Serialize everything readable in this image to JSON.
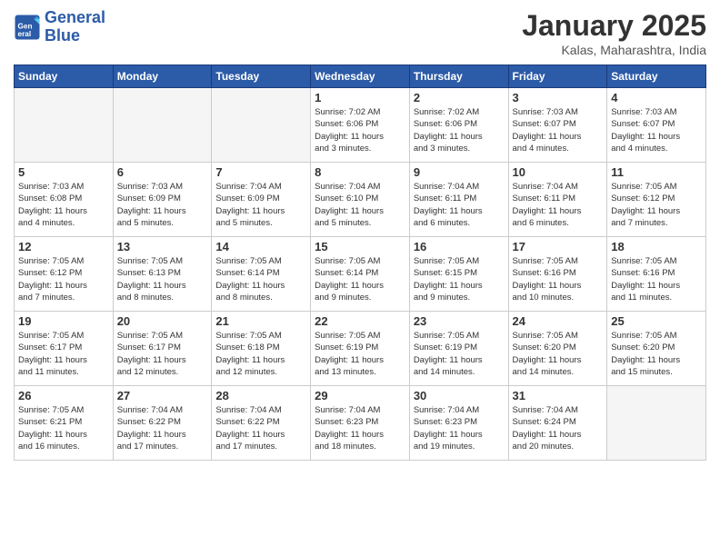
{
  "header": {
    "logo_line1": "General",
    "logo_line2": "Blue",
    "month": "January 2025",
    "location": "Kalas, Maharashtra, India"
  },
  "weekdays": [
    "Sunday",
    "Monday",
    "Tuesday",
    "Wednesday",
    "Thursday",
    "Friday",
    "Saturday"
  ],
  "weeks": [
    [
      {
        "day": "",
        "info": ""
      },
      {
        "day": "",
        "info": ""
      },
      {
        "day": "",
        "info": ""
      },
      {
        "day": "1",
        "info": "Sunrise: 7:02 AM\nSunset: 6:06 PM\nDaylight: 11 hours\nand 3 minutes."
      },
      {
        "day": "2",
        "info": "Sunrise: 7:02 AM\nSunset: 6:06 PM\nDaylight: 11 hours\nand 3 minutes."
      },
      {
        "day": "3",
        "info": "Sunrise: 7:03 AM\nSunset: 6:07 PM\nDaylight: 11 hours\nand 4 minutes."
      },
      {
        "day": "4",
        "info": "Sunrise: 7:03 AM\nSunset: 6:07 PM\nDaylight: 11 hours\nand 4 minutes."
      }
    ],
    [
      {
        "day": "5",
        "info": "Sunrise: 7:03 AM\nSunset: 6:08 PM\nDaylight: 11 hours\nand 4 minutes."
      },
      {
        "day": "6",
        "info": "Sunrise: 7:03 AM\nSunset: 6:09 PM\nDaylight: 11 hours\nand 5 minutes."
      },
      {
        "day": "7",
        "info": "Sunrise: 7:04 AM\nSunset: 6:09 PM\nDaylight: 11 hours\nand 5 minutes."
      },
      {
        "day": "8",
        "info": "Sunrise: 7:04 AM\nSunset: 6:10 PM\nDaylight: 11 hours\nand 5 minutes."
      },
      {
        "day": "9",
        "info": "Sunrise: 7:04 AM\nSunset: 6:11 PM\nDaylight: 11 hours\nand 6 minutes."
      },
      {
        "day": "10",
        "info": "Sunrise: 7:04 AM\nSunset: 6:11 PM\nDaylight: 11 hours\nand 6 minutes."
      },
      {
        "day": "11",
        "info": "Sunrise: 7:05 AM\nSunset: 6:12 PM\nDaylight: 11 hours\nand 7 minutes."
      }
    ],
    [
      {
        "day": "12",
        "info": "Sunrise: 7:05 AM\nSunset: 6:12 PM\nDaylight: 11 hours\nand 7 minutes."
      },
      {
        "day": "13",
        "info": "Sunrise: 7:05 AM\nSunset: 6:13 PM\nDaylight: 11 hours\nand 8 minutes."
      },
      {
        "day": "14",
        "info": "Sunrise: 7:05 AM\nSunset: 6:14 PM\nDaylight: 11 hours\nand 8 minutes."
      },
      {
        "day": "15",
        "info": "Sunrise: 7:05 AM\nSunset: 6:14 PM\nDaylight: 11 hours\nand 9 minutes."
      },
      {
        "day": "16",
        "info": "Sunrise: 7:05 AM\nSunset: 6:15 PM\nDaylight: 11 hours\nand 9 minutes."
      },
      {
        "day": "17",
        "info": "Sunrise: 7:05 AM\nSunset: 6:16 PM\nDaylight: 11 hours\nand 10 minutes."
      },
      {
        "day": "18",
        "info": "Sunrise: 7:05 AM\nSunset: 6:16 PM\nDaylight: 11 hours\nand 11 minutes."
      }
    ],
    [
      {
        "day": "19",
        "info": "Sunrise: 7:05 AM\nSunset: 6:17 PM\nDaylight: 11 hours\nand 11 minutes."
      },
      {
        "day": "20",
        "info": "Sunrise: 7:05 AM\nSunset: 6:17 PM\nDaylight: 11 hours\nand 12 minutes."
      },
      {
        "day": "21",
        "info": "Sunrise: 7:05 AM\nSunset: 6:18 PM\nDaylight: 11 hours\nand 12 minutes."
      },
      {
        "day": "22",
        "info": "Sunrise: 7:05 AM\nSunset: 6:19 PM\nDaylight: 11 hours\nand 13 minutes."
      },
      {
        "day": "23",
        "info": "Sunrise: 7:05 AM\nSunset: 6:19 PM\nDaylight: 11 hours\nand 14 minutes."
      },
      {
        "day": "24",
        "info": "Sunrise: 7:05 AM\nSunset: 6:20 PM\nDaylight: 11 hours\nand 14 minutes."
      },
      {
        "day": "25",
        "info": "Sunrise: 7:05 AM\nSunset: 6:20 PM\nDaylight: 11 hours\nand 15 minutes."
      }
    ],
    [
      {
        "day": "26",
        "info": "Sunrise: 7:05 AM\nSunset: 6:21 PM\nDaylight: 11 hours\nand 16 minutes."
      },
      {
        "day": "27",
        "info": "Sunrise: 7:04 AM\nSunset: 6:22 PM\nDaylight: 11 hours\nand 17 minutes."
      },
      {
        "day": "28",
        "info": "Sunrise: 7:04 AM\nSunset: 6:22 PM\nDaylight: 11 hours\nand 17 minutes."
      },
      {
        "day": "29",
        "info": "Sunrise: 7:04 AM\nSunset: 6:23 PM\nDaylight: 11 hours\nand 18 minutes."
      },
      {
        "day": "30",
        "info": "Sunrise: 7:04 AM\nSunset: 6:23 PM\nDaylight: 11 hours\nand 19 minutes."
      },
      {
        "day": "31",
        "info": "Sunrise: 7:04 AM\nSunset: 6:24 PM\nDaylight: 11 hours\nand 20 minutes."
      },
      {
        "day": "",
        "info": ""
      }
    ]
  ]
}
